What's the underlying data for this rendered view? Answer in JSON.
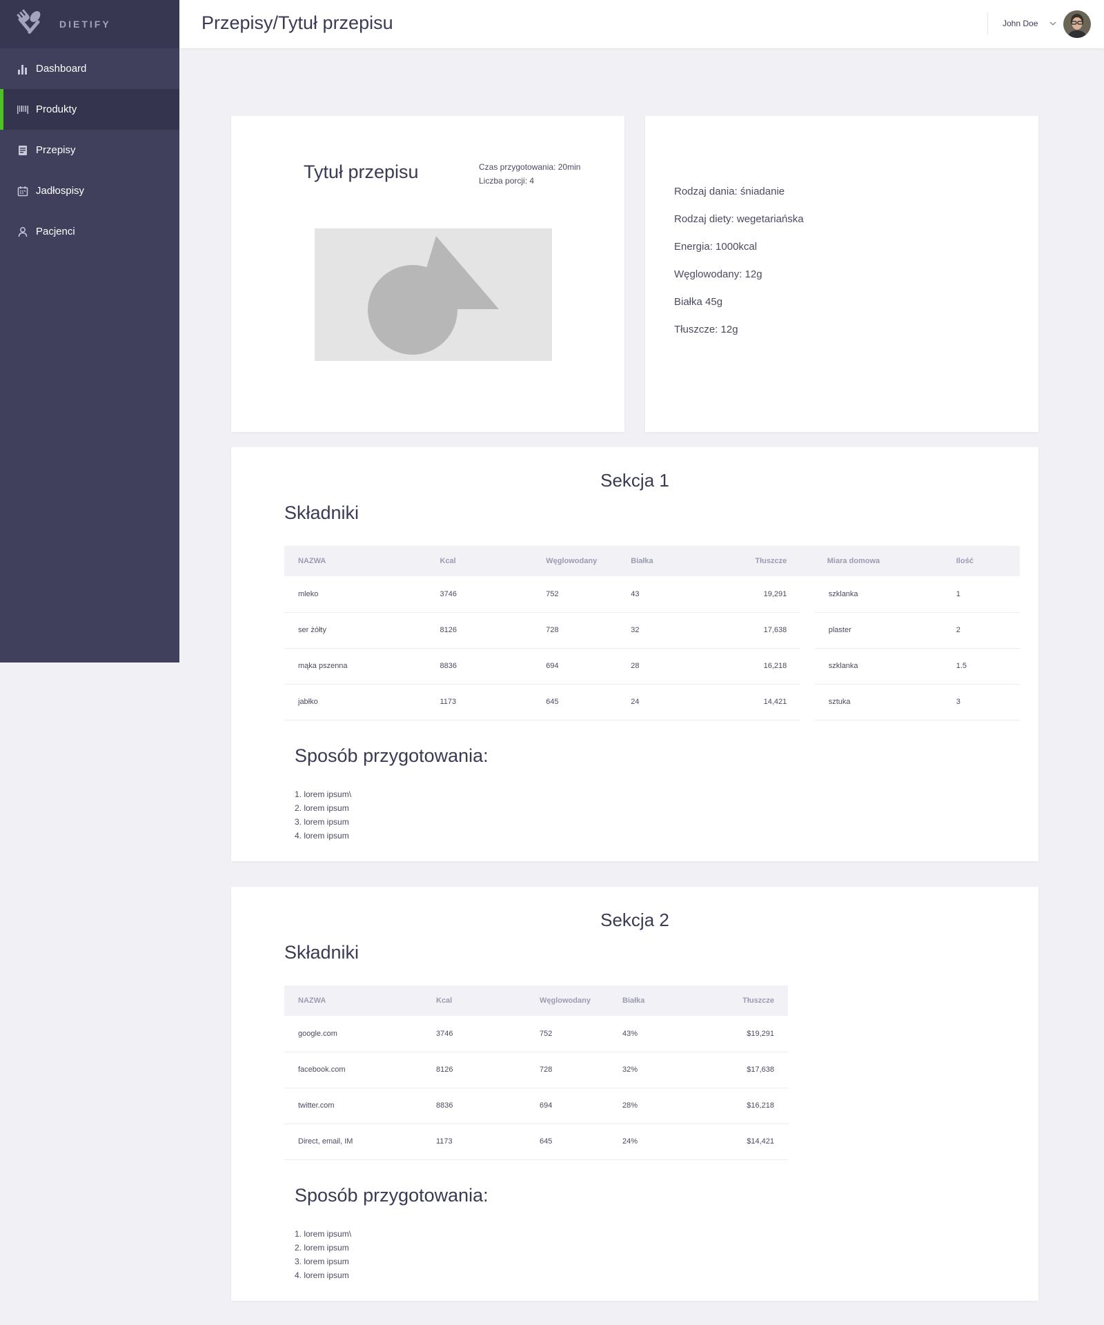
{
  "brand": {
    "name": "DIETIFY"
  },
  "nav": [
    {
      "label": "Dashboard"
    },
    {
      "label": "Produkty"
    },
    {
      "label": "Przepisy"
    },
    {
      "label": "Jadłospisy"
    },
    {
      "label": "Pacjenci"
    }
  ],
  "header": {
    "title": "Przepisy/Tytuł przepisu",
    "user_name": "John Doe"
  },
  "recipe": {
    "title": "Tytuł przepisu",
    "prep_time": "Czas przygotowania: 20min",
    "portions": "Liczba porcji: 4"
  },
  "info": [
    "Rodzaj dania: śniadanie",
    "Rodzaj diety: wegetariańska",
    "Energia: 1000kcal",
    "Węglowodany: 12g",
    "Białka 45g",
    "Tłuszcze: 12g"
  ],
  "sections": [
    {
      "title": "Sekcja 1",
      "ingredients_title": "Składniki",
      "columns": [
        "NAZWA",
        "Kcal",
        "Węglowodany",
        "Białka",
        "Tłuszcze",
        "Miara domowa",
        "Ilość"
      ],
      "rows": [
        [
          "mleko",
          "3746",
          "752",
          "43",
          "19,291",
          "szklanka",
          "1"
        ],
        [
          "ser żółty",
          "8126",
          "728",
          "32",
          "17,638",
          "plaster",
          "2"
        ],
        [
          "mąka pszenna",
          "8836",
          "694",
          "28",
          "16,218",
          "szklanka",
          "1.5"
        ],
        [
          "jabłko",
          "1173",
          "645",
          "24",
          "14,421",
          "sztuka",
          "3"
        ]
      ],
      "prep_title": "Sposób przygotowania:",
      "steps": [
        "1. lorem ipsum\\",
        "2. lorem ipsum",
        "3. lorem ipsum",
        "4. lorem ipsum"
      ]
    },
    {
      "title": "Sekcja 2",
      "ingredients_title": "Składniki",
      "columns": [
        "NAZWA",
        "Kcal",
        "Węglowodany",
        "Białka",
        "Tłuszcze"
      ],
      "rows": [
        [
          "google.com",
          "3746",
          "752",
          "43%",
          "$19,291"
        ],
        [
          "facebook.com",
          "8126",
          "728",
          "32%",
          "$17,638"
        ],
        [
          "twitter.com",
          "8836",
          "694",
          "28%",
          "$16,218"
        ],
        [
          "Direct, email, IM",
          "1173",
          "645",
          "24%",
          "$14,421"
        ]
      ],
      "prep_title": "Sposób przygotowania:",
      "steps": [
        "1. lorem ipsum\\",
        "2. lorem ipsum",
        "3. lorem ipsum",
        "4. lorem ipsum"
      ]
    }
  ]
}
